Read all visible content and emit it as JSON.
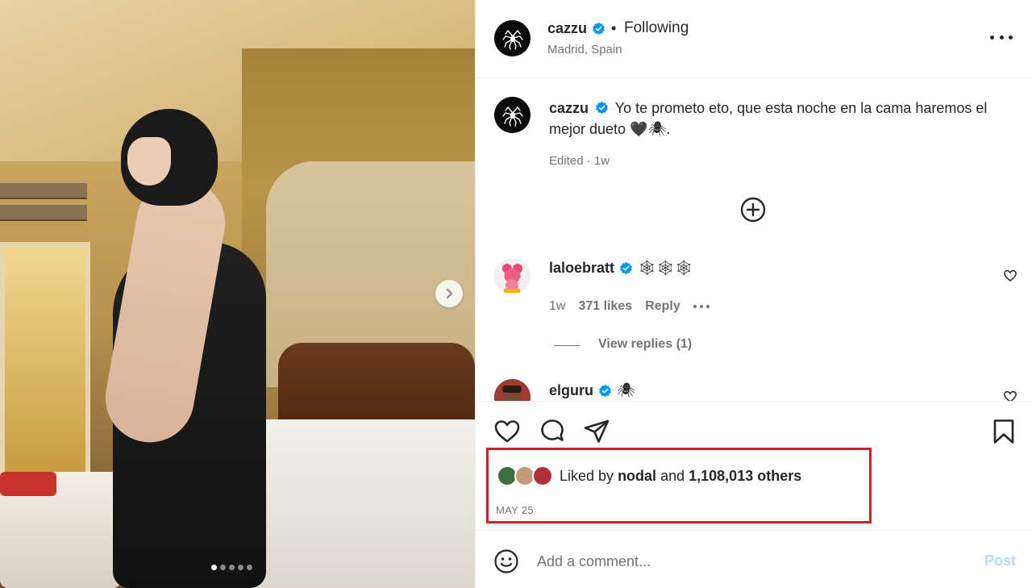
{
  "post": {
    "author": "cazzu",
    "follow_separator": "•",
    "follow_status": "Following",
    "location": "Madrid, Spain"
  },
  "caption": {
    "author": "cazzu",
    "text": "Yo te prometo eto, que esta noche en la cama haremos el mejor dueto 🖤🕷.",
    "meta": "Edited · 1w"
  },
  "comments": [
    {
      "author": "laloebratt",
      "text": "🕸🕸🕸",
      "age": "1w",
      "likes": "371 likes",
      "reply_label": "Reply",
      "view_replies": "View replies (1)"
    },
    {
      "author": "elguru",
      "text": "🕷"
    }
  ],
  "likes": {
    "prefix": "Liked by",
    "liker": "nodal",
    "connector": "and",
    "others": "1,108,013 others",
    "date": "MAY 25"
  },
  "composer": {
    "placeholder": "Add a comment...",
    "post_label": "Post"
  },
  "carousel": {
    "total_slides": 5,
    "active_slide": 1
  },
  "colors": {
    "verified": "#0095f6",
    "highlight_box": "#d0202a",
    "post_button": "#b3dbff"
  },
  "icons": [
    "verified-badge-icon",
    "more-options-icon",
    "add-icon",
    "heart-icon",
    "comment-icon",
    "share-icon",
    "bookmark-icon",
    "emoji-icon",
    "chevron-right-icon"
  ]
}
